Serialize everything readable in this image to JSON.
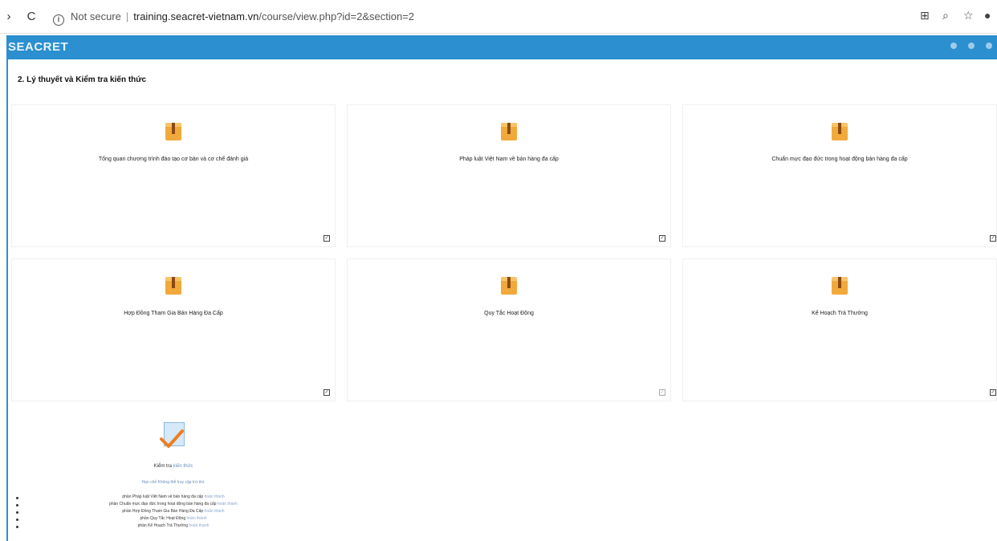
{
  "browser": {
    "back_icon": "back-arrow-icon",
    "reload_icon": "reload-icon",
    "security_label": "Not secure",
    "url_host": "training.seacret-vietnam.vn",
    "url_path": "/course/view.php?id=2&section=2"
  },
  "site": {
    "logo_text": "SEACRET",
    "brand_color": "#2b8fd0"
  },
  "section": {
    "title": "2. Lý thuyết và Kiểm tra kiến thức"
  },
  "cards": [
    {
      "title": "Tổng quan chương trình đào tạo cơ bản và cơ chế đánh giá",
      "icon": "package-icon"
    },
    {
      "title": "Pháp luật Việt Nam về bán hàng đa cấp",
      "icon": "package-icon"
    },
    {
      "title": "Chuẩn mực đạo đức trong hoạt động bán hàng đa cấp",
      "icon": "package-icon"
    },
    {
      "title": "Hợp Đồng Tham Gia Bán Hàng Đa Cấp",
      "icon": "package-icon"
    },
    {
      "title": "Quy Tắc Hoạt Động",
      "icon": "package-icon"
    },
    {
      "title": "Kế Hoạch Trả Thưởng",
      "icon": "package-icon"
    }
  ],
  "quiz": {
    "title_a": "Kiểm tra ",
    "title_b": "kiến thức",
    "sub": "Hạn chế   Không thể truy cập trừ khi:",
    "items": [
      {
        "a": "phần Pháp luật Việt Nam về bán hàng đa cấp",
        "b": " hoàn thành"
      },
      {
        "a": "phần Chuẩn mực đạo đức trong hoạt động bán hàng đa cấp",
        "b": " hoàn thành"
      },
      {
        "a": "phần Hợp Đồng Tham Gia Bán Hàng Đa Cấp",
        "b": " hoàn thành"
      },
      {
        "a": "phần Quy Tắc Hoạt Động",
        "b": " hoàn thành"
      },
      {
        "a": "phần Kế Hoạch Trả Thưởng",
        "b": " hoàn thành"
      }
    ]
  }
}
